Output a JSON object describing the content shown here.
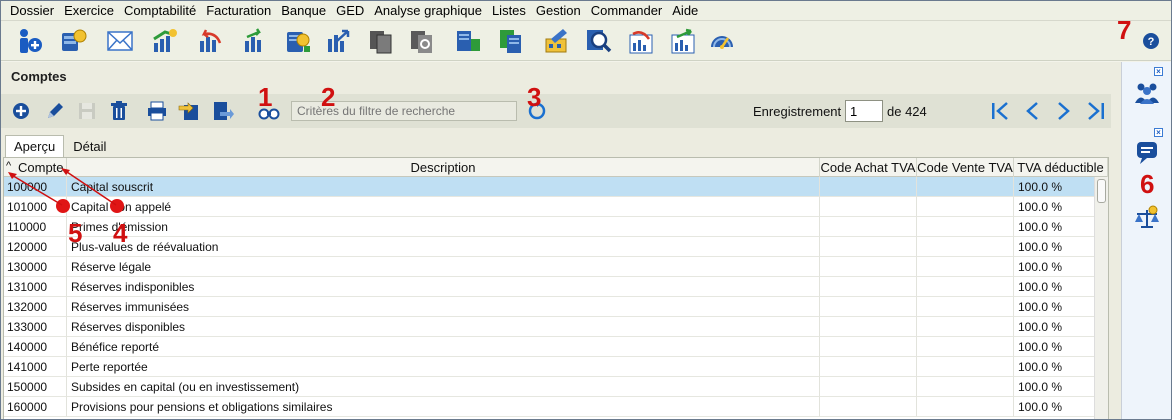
{
  "menu": [
    "Dossier",
    "Exercice",
    "Comptabilité",
    "Facturation",
    "Banque",
    "GED",
    "Analyse graphique",
    "Listes",
    "Gestion",
    "Commander",
    "Aide"
  ],
  "toolbar_icons": [
    "add-info-icon",
    "coins-icon",
    "envelope-icon",
    "chart-money-icon",
    "chart-undo-icon",
    "chart-forward-icon",
    "coin-chart-icon",
    "coin-share-icon",
    "copy-docs-icon",
    "gear-doc-icon",
    "doc-chart-icon",
    "docs-chart-icon",
    "pencil-box-icon",
    "search-doc-icon",
    "chart-undo-2-icon",
    "chart-forward-2-icon",
    "gauge-icon"
  ],
  "panel": {
    "title": "Comptes",
    "search_placeholder": "Critères du filtre de recherche",
    "record_label": "Enregistrement",
    "record_value": "1",
    "record_of": "de 424"
  },
  "tabs": [
    "Aperçu",
    "Détail"
  ],
  "grid": {
    "columns": [
      "Compte",
      "Description",
      "Code Achat TVA",
      "Code Vente TVA",
      "TVA déductible"
    ],
    "rows": [
      [
        "100000",
        "Capital souscrit",
        "",
        "",
        "100.0 %"
      ],
      [
        "101000",
        "Capital non appelé",
        "",
        "",
        "100.0 %"
      ],
      [
        "110000",
        "Primes d'émission",
        "",
        "",
        "100.0 %"
      ],
      [
        "120000",
        "Plus-values de réévaluation",
        "",
        "",
        "100.0 %"
      ],
      [
        "130000",
        "Réserve légale",
        "",
        "",
        "100.0 %"
      ],
      [
        "131000",
        "Réserves indisponibles",
        "",
        "",
        "100.0 %"
      ],
      [
        "132000",
        "Réserves immunisées",
        "",
        "",
        "100.0 %"
      ],
      [
        "133000",
        "Réserves disponibles",
        "",
        "",
        "100.0 %"
      ],
      [
        "140000",
        "Bénéfice reporté",
        "",
        "",
        "100.0 %"
      ],
      [
        "141000",
        "Perte reportée",
        "",
        "",
        "100.0 %"
      ],
      [
        "150000",
        "Subsides en capital (ou en investissement)",
        "",
        "",
        "100.0 %"
      ],
      [
        "160000",
        "Provisions pour pensions et obligations similaires",
        "",
        "",
        "100.0 %"
      ]
    ]
  },
  "annotations": [
    "1",
    "2",
    "3",
    "4",
    "5",
    "6",
    "7"
  ],
  "colors": {
    "selected_row": "#bfdff3",
    "annotation": "#d01010",
    "accent": "#1a5cc2"
  }
}
